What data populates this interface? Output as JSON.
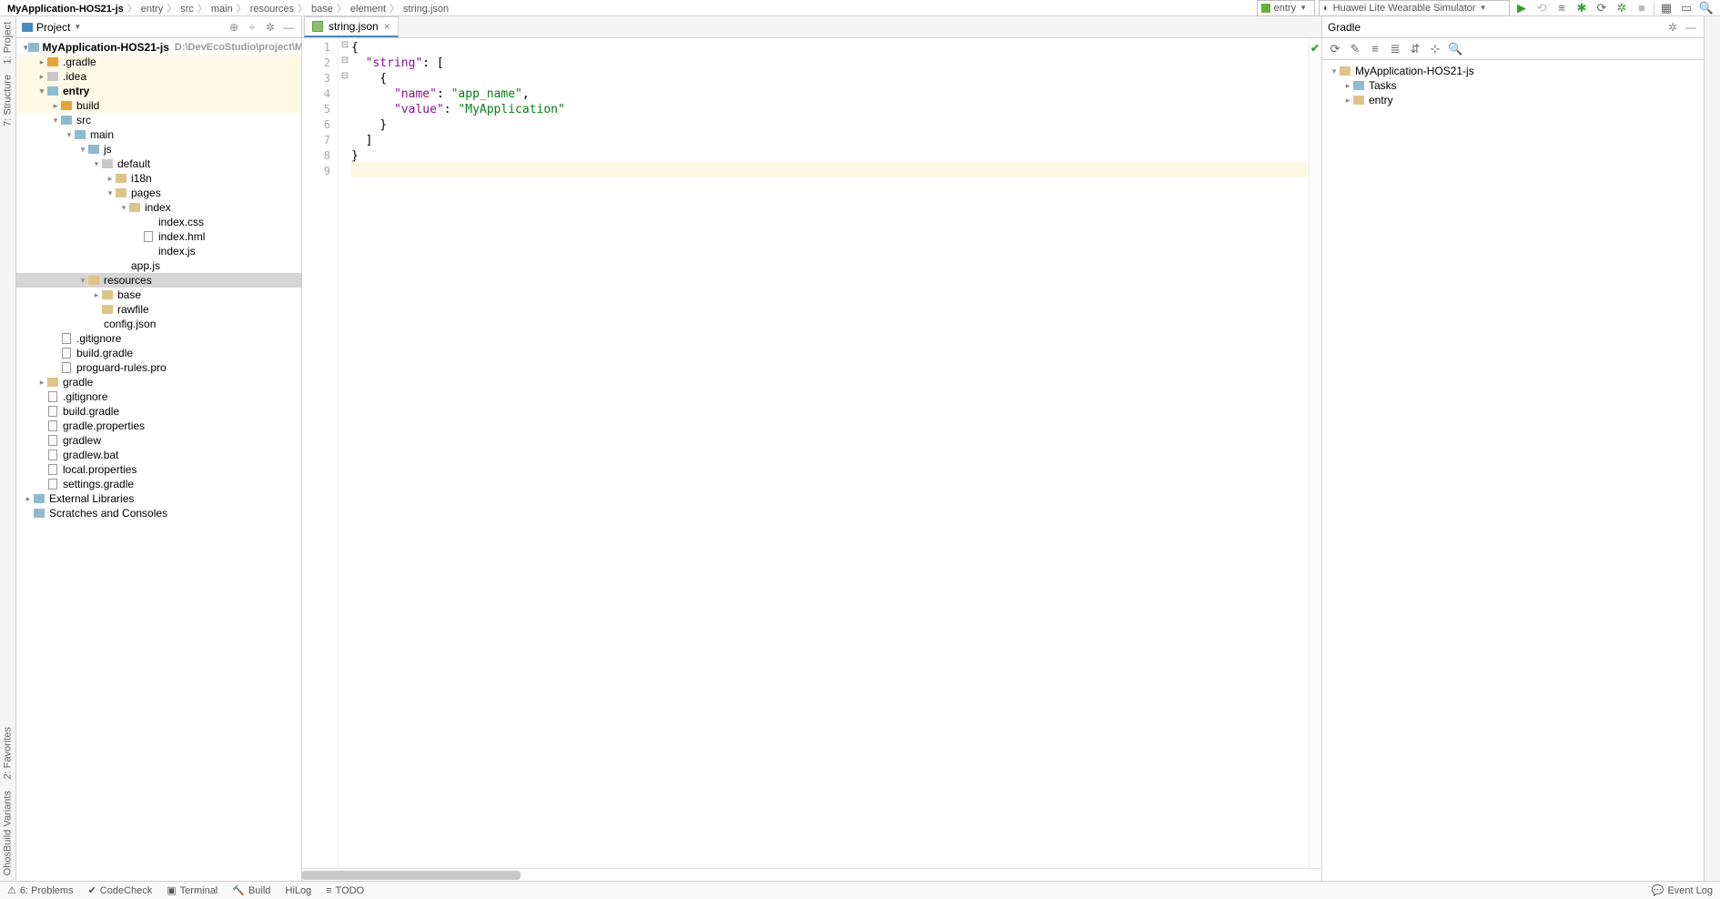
{
  "breadcrumb": [
    "MyApplication-HOS21-js",
    "entry",
    "src",
    "main",
    "resources",
    "base",
    "element",
    "string.json"
  ],
  "toolbar": {
    "run_config": "entry",
    "device": "Huawei Lite Wearable Simulator"
  },
  "project_panel": {
    "title": "Project",
    "root_name": "MyApplication-HOS21-js",
    "root_path": "D:\\DevEcoStudio\\project\\MyAp"
  },
  "tree": [
    {
      "d": 0,
      "arr": "down",
      "ico": "folder-cyan",
      "txt": "MyApplication-HOS21-js",
      "bold": true,
      "hint": "D:\\DevEcoStudio\\project\\MyAp"
    },
    {
      "d": 1,
      "arr": "right",
      "ico": "folder-orange",
      "txt": ".gradle",
      "hi": true
    },
    {
      "d": 1,
      "arr": "right",
      "ico": "folder-gray",
      "txt": ".idea",
      "hi": true
    },
    {
      "d": 1,
      "arr": "down",
      "ico": "folder-cyan",
      "txt": "entry",
      "bold": true,
      "hi": true
    },
    {
      "d": 2,
      "arr": "right",
      "ico": "folder-orange",
      "txt": "build",
      "hi": true
    },
    {
      "d": 2,
      "arr": "down",
      "ico": "folder-cyan",
      "txt": "src"
    },
    {
      "d": 3,
      "arr": "down",
      "ico": "folder-cyan",
      "txt": "main"
    },
    {
      "d": 4,
      "arr": "down",
      "ico": "folder-cyan",
      "txt": "js"
    },
    {
      "d": 5,
      "arr": "down",
      "ico": "folder-gray",
      "txt": "default"
    },
    {
      "d": 6,
      "arr": "right",
      "ico": "folder-closed",
      "txt": "i18n"
    },
    {
      "d": 6,
      "arr": "down",
      "ico": "folder-closed",
      "txt": "pages"
    },
    {
      "d": 7,
      "arr": "down",
      "ico": "folder-closed",
      "txt": "index"
    },
    {
      "d": 8,
      "arr": "none",
      "ico": "file-css",
      "txt": "index.css"
    },
    {
      "d": 8,
      "arr": "none",
      "ico": "file-ico",
      "txt": "index.hml"
    },
    {
      "d": 8,
      "arr": "none",
      "ico": "file-js",
      "txt": "index.js"
    },
    {
      "d": 6,
      "arr": "none",
      "ico": "file-js",
      "txt": "app.js"
    },
    {
      "d": 4,
      "arr": "down",
      "ico": "folder-closed",
      "txt": "resources",
      "sel": true
    },
    {
      "d": 5,
      "arr": "right",
      "ico": "folder-closed",
      "txt": "base"
    },
    {
      "d": 5,
      "arr": "none",
      "ico": "folder-closed",
      "txt": "rawfile"
    },
    {
      "d": 4,
      "arr": "none",
      "ico": "file-json",
      "txt": "config.json"
    },
    {
      "d": 2,
      "arr": "none",
      "ico": "file-ico",
      "txt": ".gitignore"
    },
    {
      "d": 2,
      "arr": "none",
      "ico": "file-ico",
      "txt": "build.gradle"
    },
    {
      "d": 2,
      "arr": "none",
      "ico": "file-ico",
      "txt": "proguard-rules.pro"
    },
    {
      "d": 1,
      "arr": "right",
      "ico": "folder-closed",
      "txt": "gradle"
    },
    {
      "d": 1,
      "arr": "none",
      "ico": "file-ico",
      "txt": ".gitignore"
    },
    {
      "d": 1,
      "arr": "none",
      "ico": "file-ico",
      "txt": "build.gradle"
    },
    {
      "d": 1,
      "arr": "none",
      "ico": "file-ico",
      "txt": "gradle.properties"
    },
    {
      "d": 1,
      "arr": "none",
      "ico": "file-ico",
      "txt": "gradlew"
    },
    {
      "d": 1,
      "arr": "none",
      "ico": "file-ico",
      "txt": "gradlew.bat"
    },
    {
      "d": 1,
      "arr": "none",
      "ico": "file-ico",
      "txt": "local.properties"
    },
    {
      "d": 1,
      "arr": "none",
      "ico": "file-ico",
      "txt": "settings.gradle"
    },
    {
      "d": 0,
      "arr": "right",
      "ico": "folder-cyan",
      "txt": "External Libraries"
    },
    {
      "d": 0,
      "arr": "none",
      "ico": "folder-cyan",
      "txt": "Scratches and Consoles"
    }
  ],
  "editor": {
    "tab_name": "string.json",
    "line_count": 9,
    "tokens": [
      [
        {
          "c": "p",
          "t": "{"
        }
      ],
      [
        {
          "c": "p",
          "t": "  "
        },
        {
          "c": "k",
          "t": "\"string\""
        },
        {
          "c": "p",
          "t": ": ["
        }
      ],
      [
        {
          "c": "p",
          "t": "    {"
        }
      ],
      [
        {
          "c": "p",
          "t": "      "
        },
        {
          "c": "k",
          "t": "\"name\""
        },
        {
          "c": "p",
          "t": ": "
        },
        {
          "c": "s",
          "t": "\"app_name\""
        },
        {
          "c": "p",
          "t": ","
        }
      ],
      [
        {
          "c": "p",
          "t": "      "
        },
        {
          "c": "k",
          "t": "\"value\""
        },
        {
          "c": "p",
          "t": ": "
        },
        {
          "c": "s",
          "t": "\"MyApplication\""
        }
      ],
      [
        {
          "c": "p",
          "t": "    }"
        }
      ],
      [
        {
          "c": "p",
          "t": "  ]"
        }
      ],
      [
        {
          "c": "p",
          "t": "}"
        }
      ],
      []
    ],
    "folds": [
      "⊟",
      "⊟",
      "⊟",
      "",
      "",
      "",
      "",
      "",
      ""
    ]
  },
  "gradle": {
    "title": "Gradle",
    "nodes": [
      {
        "d": 0,
        "arr": "down",
        "txt": "MyApplication-HOS21-js"
      },
      {
        "d": 1,
        "arr": "right",
        "txt": "Tasks",
        "ico": "folder-cyan"
      },
      {
        "d": 1,
        "arr": "right",
        "txt": "entry"
      }
    ]
  },
  "left_gutter": [
    "1: Project",
    "7: Structure"
  ],
  "left_gutter2": [
    "2: Favorites",
    "OhosBuild Variants"
  ],
  "bottom": {
    "items": [
      "6: Problems",
      "CodeCheck",
      "Terminal",
      "Build",
      "HiLog",
      "TODO"
    ],
    "event_log": "Event Log"
  }
}
